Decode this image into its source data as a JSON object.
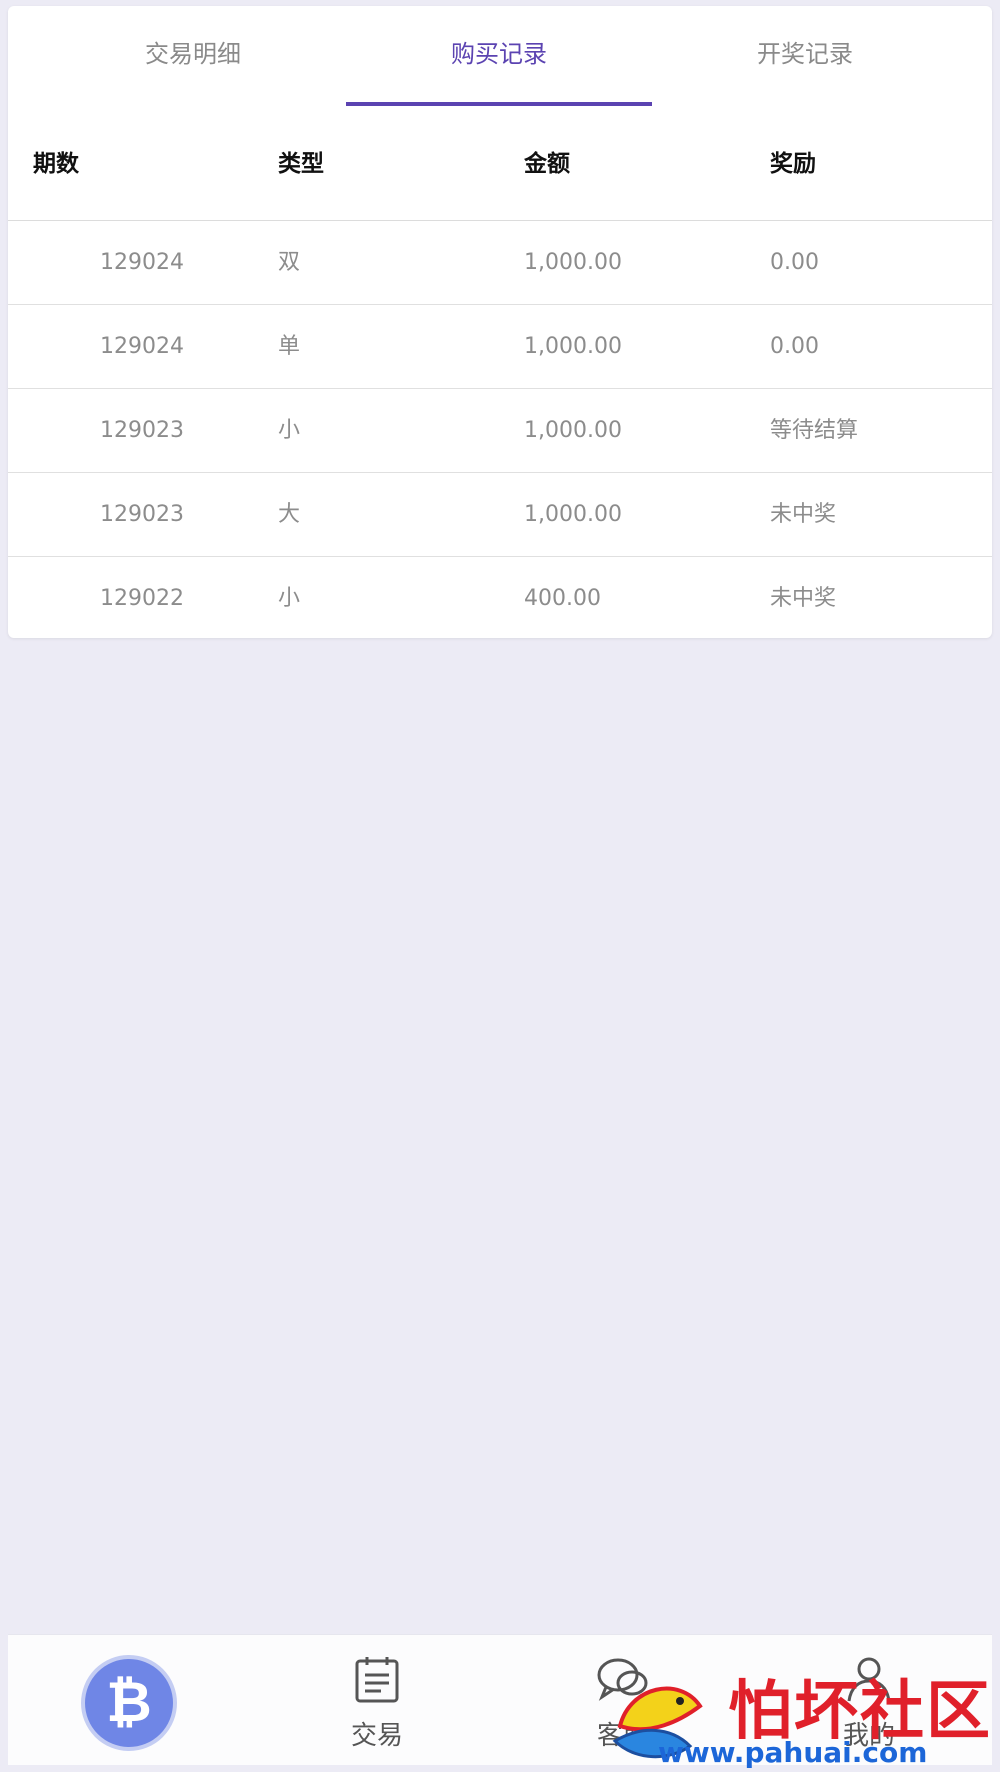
{
  "tabs": [
    {
      "label": "交易明细",
      "active": false
    },
    {
      "label": "购买记录",
      "active": true
    },
    {
      "label": "开奖记录",
      "active": false
    }
  ],
  "accent_color": "#5b43b1",
  "table": {
    "headers": [
      "期数",
      "类型",
      "金额",
      "奖励"
    ],
    "rows": [
      {
        "period": "129024",
        "type": "双",
        "amount": "1,000.00",
        "reward": "0.00"
      },
      {
        "period": "129024",
        "type": "单",
        "amount": "1,000.00",
        "reward": "0.00"
      },
      {
        "period": "129023",
        "type": "小",
        "amount": "1,000.00",
        "reward": "等待结算"
      },
      {
        "period": "129023",
        "type": "大",
        "amount": "1,000.00",
        "reward": "未中奖"
      },
      {
        "period": "129022",
        "type": "小",
        "amount": "400.00",
        "reward": "未中奖"
      }
    ]
  },
  "bottom_nav": {
    "items": [
      {
        "label": "",
        "icon": "bitcoin-icon"
      },
      {
        "label": "交易",
        "icon": "notepad-icon"
      },
      {
        "label": "客服",
        "icon": "chat-bubbles-icon"
      },
      {
        "label": "我的",
        "icon": "user-icon"
      }
    ]
  },
  "watermark": {
    "title": "怕坏社区",
    "url": "www.pahuai.com"
  }
}
